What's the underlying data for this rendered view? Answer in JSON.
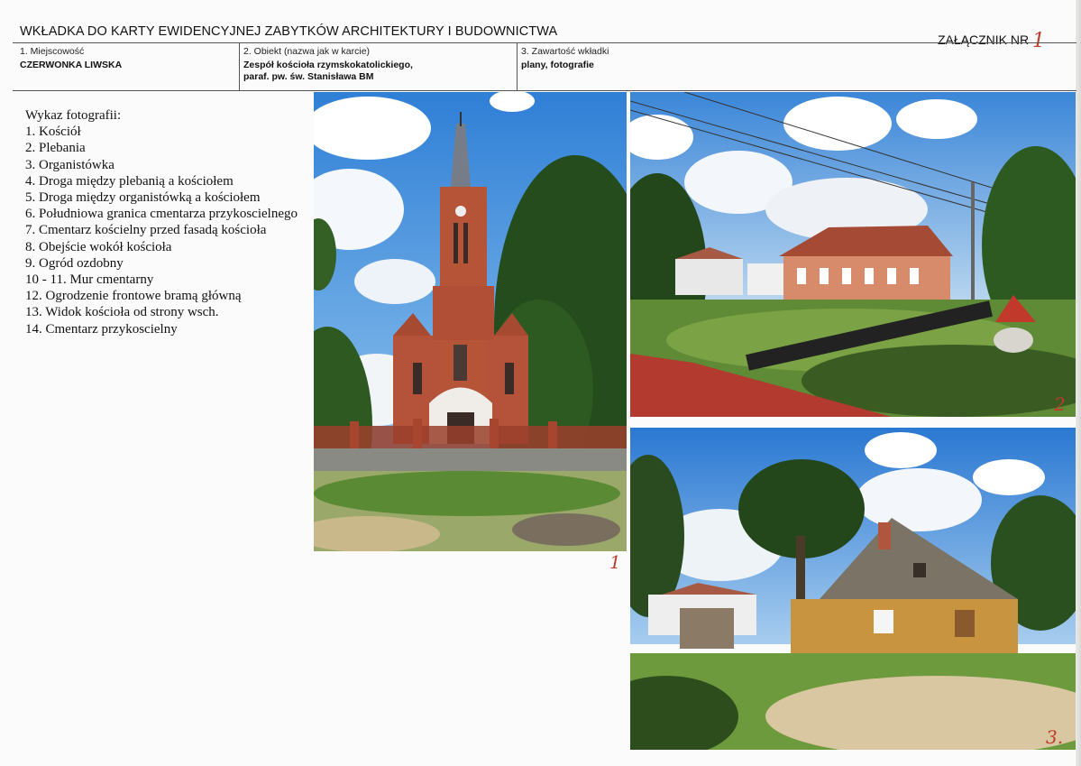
{
  "header": {
    "title": "WKŁADKA DO KARTY EWIDENCYJNEJ ZABYTKÓW ARCHITEKTURY I BUDOWNICTWA",
    "annex_label": "ZAŁĄCZNIK NR",
    "annex_number": "1"
  },
  "fields": {
    "locality_label": "1. Miejscowość",
    "locality_value": "CZERWONKA LIWSKA",
    "object_label": "2. Obiekt (nazwa jak w karcie)",
    "object_value_line1": "Zespół kościoła rzymskokatolickiego,",
    "object_value_line2": "paraf. pw. św. Stanisława BM",
    "contents_label": "3. Zawartość wkładki",
    "contents_value": "plany, fotografie"
  },
  "photo_list": {
    "heading": "Wykaz fotografii:",
    "items": [
      "1. Kościół",
      "2. Plebania",
      "3. Organistówka",
      "4. Droga między plebanią a kościołem",
      "5. Droga między organistówką a kościołem",
      "6. Południowa granica cmentarza przykoscielnego",
      "7. Cmentarz kościelny przed fasadą kościoła",
      "8. Obejście wokół kościoła",
      "9. Ogród ozdobny",
      "10 - 11. Mur cmentarny",
      "12. Ogrodzenie frontowe bramą główną",
      "13. Widok kościoła od strony wsch.",
      "14. Cmentarz przykoscielny"
    ]
  },
  "photos": [
    {
      "number": "1",
      "subject": "church"
    },
    {
      "number": "2",
      "subject": "presbytery"
    },
    {
      "number": "3.",
      "subject": "organist-house"
    }
  ],
  "colors": {
    "annotation_red": "#c0392b",
    "brick": "#b5533a"
  }
}
